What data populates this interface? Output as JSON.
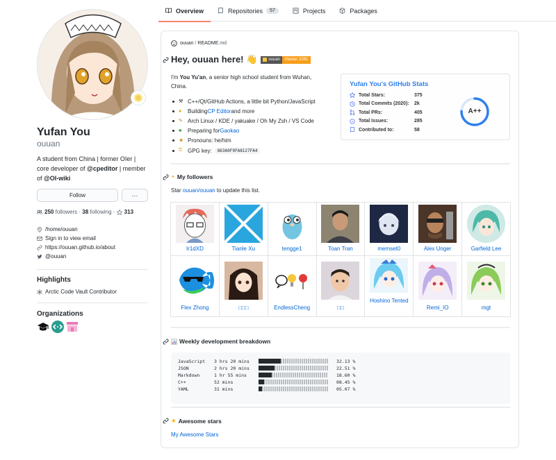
{
  "tabs": [
    {
      "label": "Overview",
      "icon": "book-icon",
      "active": true
    },
    {
      "label": "Repositories",
      "icon": "repo-icon",
      "count": "57"
    },
    {
      "label": "Projects",
      "icon": "project-icon"
    },
    {
      "label": "Packages",
      "icon": "package-icon"
    }
  ],
  "profile": {
    "full_name": "Yufan You",
    "login": "ouuan",
    "bio_1": "A student from China | former OIer |",
    "bio_2": "core developer of ",
    "bio_org1": "@cpeditor",
    "bio_3": " | member",
    "bio_4": "of ",
    "bio_org2": "@OI-wiki",
    "follow_label": "Follow",
    "more_label": "···",
    "followers_count": "250",
    "followers_label": "followers",
    "following_count": "38",
    "following_label": "following",
    "stars_count": "313",
    "location": "/home/ouuan",
    "email": "Sign in to view email",
    "website": "https://ouuan.github.io/about",
    "twitter": "@ouuan",
    "highlights_title": "Highlights",
    "highlight_1": "Arctic Code Vault Contributor",
    "orgs_title": "Organizations"
  },
  "readme": {
    "path_user": "ouuan",
    "path_sep": "/",
    "path_file": "README",
    "path_ext": ".md",
    "title": "Hey, ouuan here! 👋",
    "badge_left": "ouuan",
    "badge_right": "Master 2281",
    "intro_1": "I'm ",
    "intro_name": "You Yu'an",
    "intro_2": ", a senior high school student from Wuhan,",
    "intro_3": "China.",
    "bullets": {
      "b1": "C++/Qt/GitHub Actions, a little bit Python/JavaScript",
      "b2_pre": "Building ",
      "b2_link": "CP Editor",
      "b2_post": " and more",
      "b3": "Arch Linux / KDE / yakuake / Oh My Zsh / VS Code",
      "b4_pre": "Preparing for ",
      "b4_link": "Gaokao",
      "b5": "Pronouns: he/him",
      "b6_pre": "GPG key: ",
      "b6_code": "863A0F9FA8127FA4"
    },
    "followers_title": "My followers",
    "star_note_pre": "Star ",
    "star_note_link": "ouuan/ouuan",
    "star_note_post": " to update this list.",
    "weekly_title": "Weekly development breakdown",
    "awesome_title": "Awesome stars",
    "awesome_link": "My Awesome Stars"
  },
  "stats": {
    "title": "Yufan You's GitHub Stats",
    "rows": [
      {
        "label": "Total Stars:",
        "value": "375"
      },
      {
        "label": "Total Commits (2020):",
        "value": "2k"
      },
      {
        "label": "Total PRs:",
        "value": "405"
      },
      {
        "label": "Total Issues:",
        "value": "285"
      },
      {
        "label": "Contributed to:",
        "value": "58"
      }
    ],
    "rank": "A++",
    "accent": "#2f80ed"
  },
  "followers": [
    {
      "name": "Ir1dXD"
    },
    {
      "name": "Tianle Xu"
    },
    {
      "name": "tengge1"
    },
    {
      "name": "Toan Tran"
    },
    {
      "name": "memset0"
    },
    {
      "name": "Alex Unger"
    },
    {
      "name": "Garfield Lee"
    },
    {
      "name": "Flex Zhong"
    },
    {
      "name": "□□□"
    },
    {
      "name": "EndlessCheng"
    },
    {
      "name": "□□"
    },
    {
      "name": "Hoshino Tented"
    },
    {
      "name": "Remi_IO"
    },
    {
      "name": "mgt"
    }
  ],
  "weekly": [
    {
      "lang": "JavaScript",
      "time": "3 hrs 20 mins",
      "pct": "32.13 %",
      "fraction": 0.3213
    },
    {
      "lang": "JSON",
      "time": "2 hrs 20 mins",
      "pct": "22.51 %",
      "fraction": 0.2251
    },
    {
      "lang": "Markdown",
      "time": "1 hr 55 mins",
      "pct": "18.60 %",
      "fraction": 0.186
    },
    {
      "lang": "C++",
      "time": "52 mins",
      "pct": "08.45 %",
      "fraction": 0.0845
    },
    {
      "lang": "YAML",
      "time": "31 mins",
      "pct": "05.07 %",
      "fraction": 0.0507
    }
  ]
}
